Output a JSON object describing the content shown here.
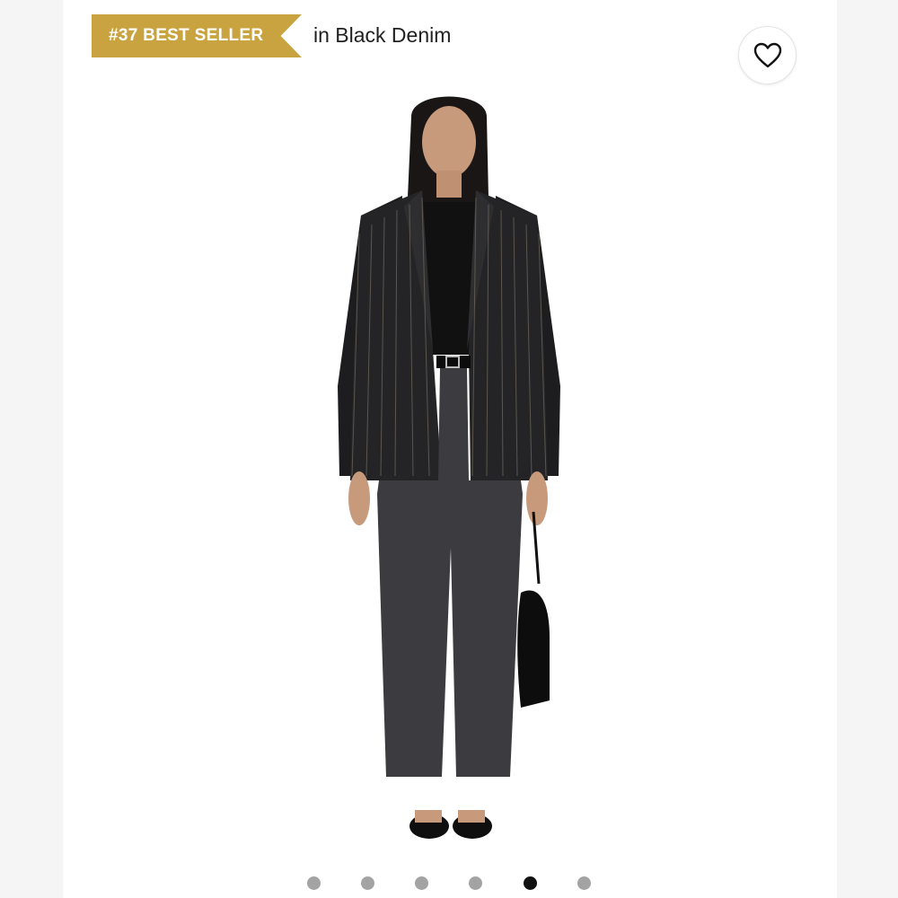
{
  "badge": {
    "label": "#37 BEST SELLER",
    "color": "#c9a33f"
  },
  "subtitle": "in Black Denim",
  "favorite_button": {
    "icon": "heart-icon"
  },
  "product_image": {
    "description_icon": "model-photo"
  },
  "carousel": {
    "total": 6,
    "active_index": 5,
    "active_color": "#111111",
    "inactive_color": "#a3a3a3"
  }
}
